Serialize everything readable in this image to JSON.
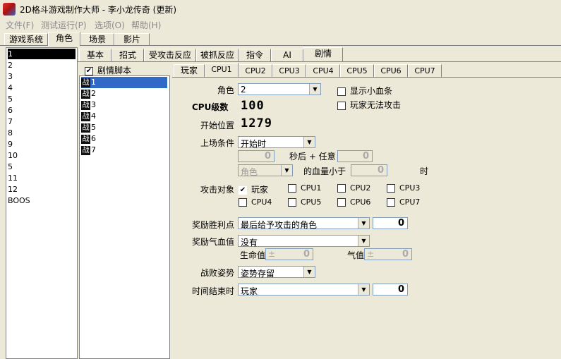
{
  "window": {
    "title": "2D格斗游戏制作大师 - 李小龙传奇 (更新)"
  },
  "menu": [
    "文件(F)",
    "测试运行(P)",
    "选项(O)",
    "帮助(H)"
  ],
  "main_tabs": [
    "游戏系统",
    "角色",
    "场景",
    "影片"
  ],
  "char_list": [
    "1",
    "2",
    "3",
    "4",
    "5",
    "6",
    "7",
    "8",
    "9",
    "10",
    "5",
    "11",
    "12",
    "BOOS"
  ],
  "sub_tabs": [
    "基本",
    "招式",
    "受攻击反应",
    "被抓反应",
    "指令",
    "AI",
    "剧情"
  ],
  "story_checkbox": {
    "checked": "✔",
    "label": "剧情脚本"
  },
  "scripts": [
    "1",
    "2",
    "3",
    "4",
    "5",
    "6",
    "7"
  ],
  "script_icon": "战",
  "cpu_tabs": [
    "玩家",
    "CPU1",
    "CPU2",
    "CPU3",
    "CPU4",
    "CPU5",
    "CPU6",
    "CPU7"
  ],
  "form": {
    "role_label": "角色",
    "role_value": "2",
    "show_hp_label": "显示小血条",
    "player_no_attack_label": "玩家无法攻击",
    "cpu_level_label": "CPU级数",
    "cpu_level_value": "100",
    "start_pos_label": "开始位置",
    "start_pos_value": "1279",
    "appear_label": "上场条件",
    "appear_value": "开始时",
    "sec_val": "0",
    "sec_label": "秒后 + 任意",
    "sec_val2": "0",
    "role_disabled": "角色",
    "hp_less_label": "的血量小于",
    "hp_less_val": "0",
    "unit_label": "时",
    "attack_target_label": "攻击对象",
    "targets": [
      "玩家",
      "CPU1",
      "CPU2",
      "CPU3",
      "CPU4",
      "CPU5",
      "CPU6",
      "CPU7"
    ],
    "reward_win_label": "奖励胜利点",
    "reward_win_value": "最后给予攻击的角色",
    "reward_win_num": "0",
    "reward_hp_label": "奖励气血值",
    "reward_hp_value": "没有",
    "life_label": "生命值",
    "life_val": "0",
    "qi_label": "气值",
    "qi_val": "0",
    "defeat_pose_label": "战败姿势",
    "defeat_pose_value": "姿势存留",
    "time_end_label": "时间结束时",
    "time_end_value": "玩家",
    "time_end_num": "0"
  }
}
